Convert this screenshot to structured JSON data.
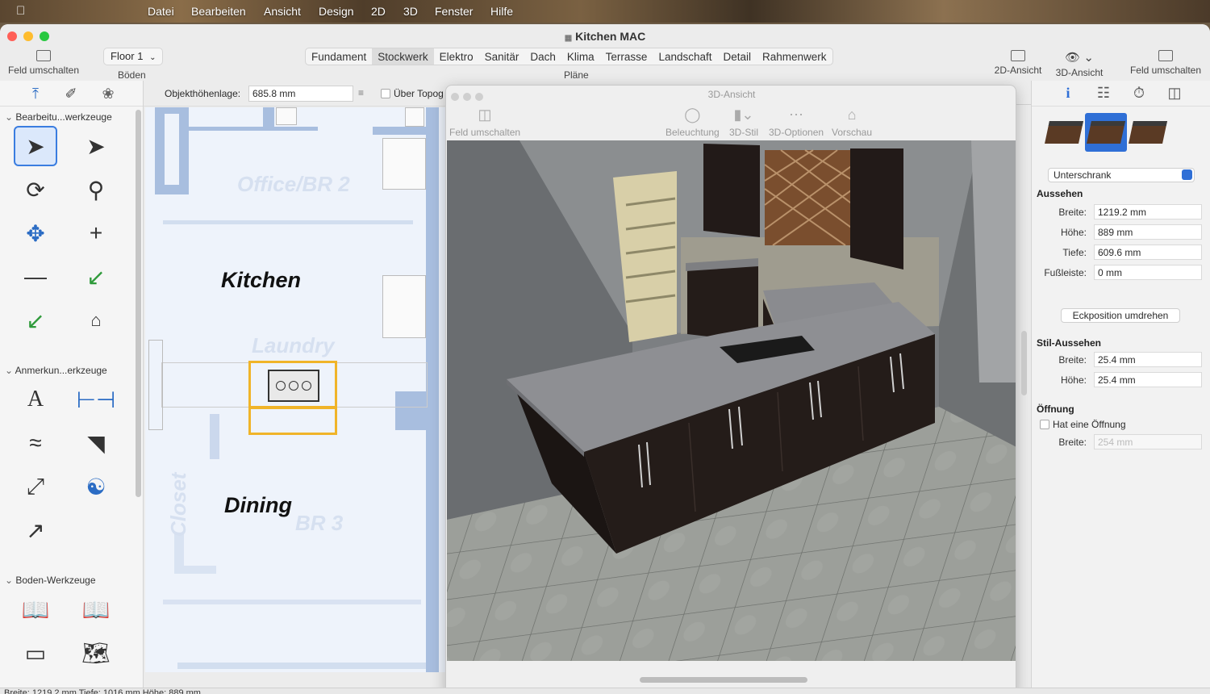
{
  "menubar": {
    "items": [
      "Datei",
      "Bearbeiten",
      "Ansicht",
      "Design",
      "2D",
      "3D",
      "Fenster",
      "Hilfe"
    ]
  },
  "window": {
    "title": "Kitchen MAC"
  },
  "toolbar": {
    "left_toggle": "Feld umschalten",
    "floor_value": "Floor 1",
    "floors_label": "Böden",
    "tabs": [
      "Fundament",
      "Stockwerk",
      "Elektro",
      "Sanitär",
      "Dach",
      "Klima",
      "Terrasse",
      "Landschaft",
      "Detail",
      "Rahmenwerk"
    ],
    "active_tab": "Stockwerk",
    "tabs_caption": "Pläne",
    "view_2d": "2D-Ansicht",
    "view_3d": "3D-Ansicht",
    "right_toggle": "Feld umschalten"
  },
  "palette": {
    "sections": [
      "Bearbeitu...werkzeuge",
      "Anmerkun...erkzeuge",
      "Boden-Werkzeuge"
    ]
  },
  "plan": {
    "height_label": "Objekthöhenlage:",
    "height_value": "685.8 mm",
    "terrain_label": "Über Topog",
    "rooms": {
      "kitchen": "Kitchen",
      "dining": "Dining",
      "office": "Office/BR 2",
      "laundry": "Laundry",
      "closet": "Closet",
      "br3": "BR 3"
    }
  },
  "view3d": {
    "title": "3D-Ansicht",
    "toggle": "Feld umschalten",
    "lighting": "Beleuchtung",
    "style": "3D-Stil",
    "options": "3D-Optionen",
    "preview": "Vorschau"
  },
  "inspector": {
    "type_value": "Unterschrank",
    "appearance_heading": "Aussehen",
    "appearance": [
      {
        "label": "Breite:",
        "value": "1219.2 mm"
      },
      {
        "label": "Höhe:",
        "value": "889 mm"
      },
      {
        "label": "Tiefe:",
        "value": "609.6 mm"
      },
      {
        "label": "Fußleiste:",
        "value": "0 mm"
      }
    ],
    "flip_button": "Eckposition umdrehen",
    "style_heading": "Stil-Aussehen",
    "style": [
      {
        "label": "Breite:",
        "value": "25.4 mm"
      },
      {
        "label": "Höhe:",
        "value": "25.4 mm"
      }
    ],
    "opening_heading": "Öffnung",
    "opening_checkbox": "Hat eine Öffnung",
    "opening_width_label": "Breite:",
    "opening_width_value": "254 mm"
  },
  "status": {
    "text": "Breite: 1219.2 mm  Tiefe: 1016 mm  Höhe: 889 mm"
  },
  "colors": {
    "accent": "#2f6fd6",
    "selection": "#f0b429",
    "wall": "#a8bedf",
    "cabinet": "#2a1f1c",
    "countertop": "#8e8f93"
  }
}
